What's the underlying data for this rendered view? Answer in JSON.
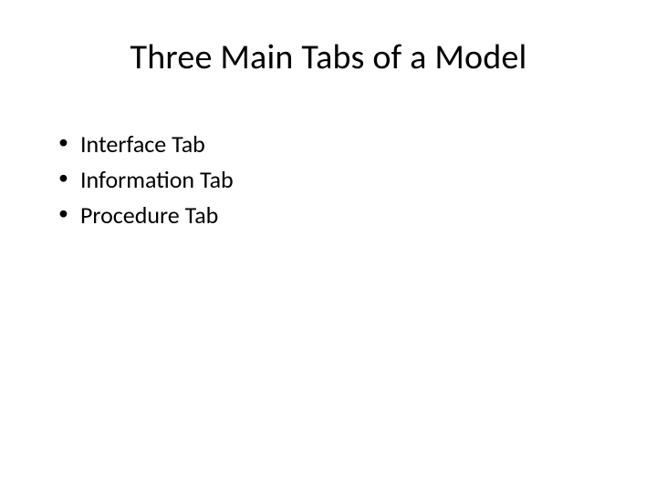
{
  "slide": {
    "title": "Three Main Tabs of a Model",
    "bullets": [
      "Interface Tab",
      "Information Tab",
      "Procedure Tab"
    ]
  }
}
